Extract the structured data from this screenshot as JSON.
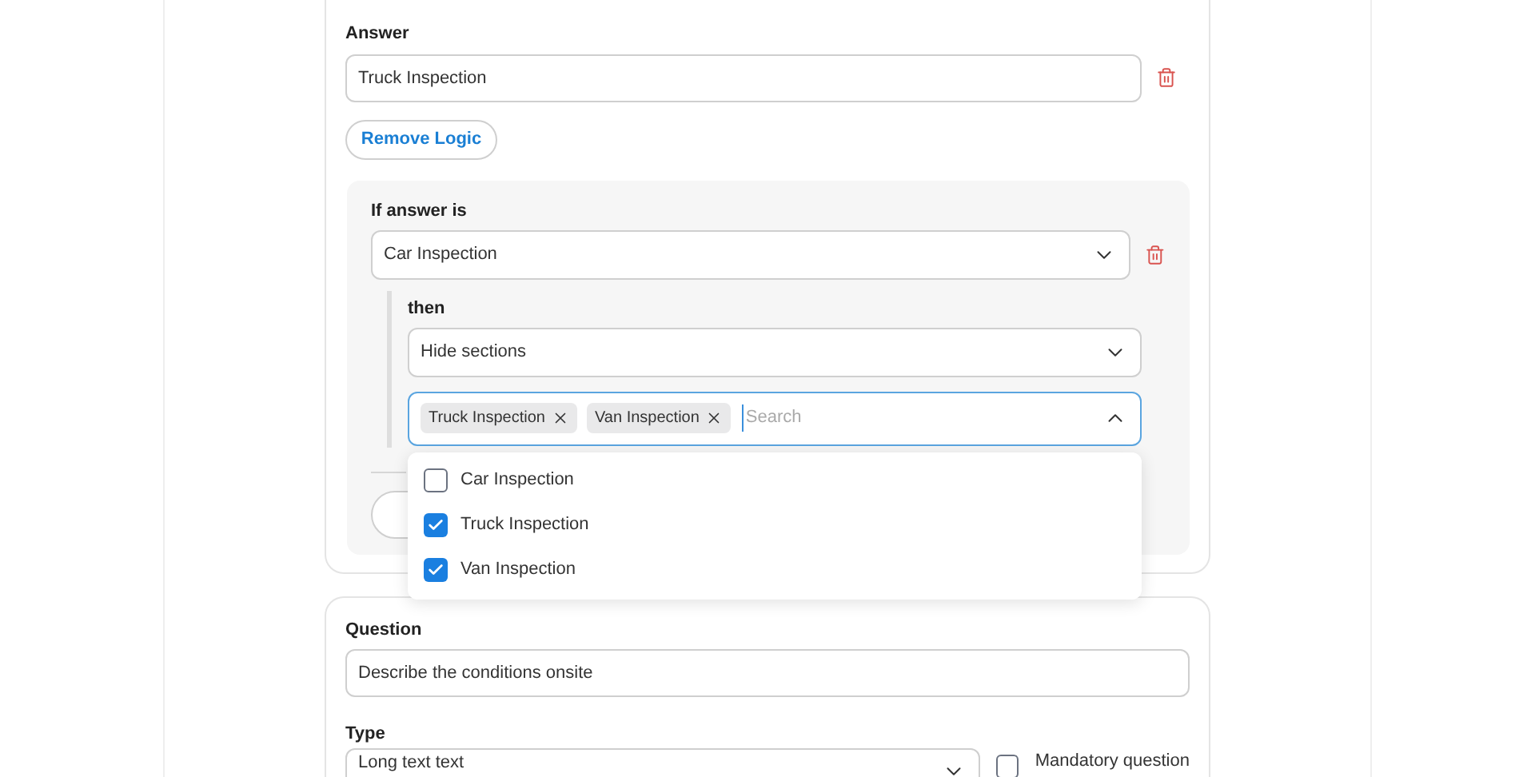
{
  "answer_card": {
    "answer_label": "Answer",
    "answer_value": "Truck Inspection",
    "remove_logic_button": "Remove Logic",
    "logic": {
      "condition_label": "If answer is",
      "condition_value": "Car Inspection",
      "then_label": "then",
      "action_value": "Hide sections",
      "sections_field": {
        "placeholder": "Search",
        "expanded": true,
        "tags": [
          {
            "label": "Truck Inspection"
          },
          {
            "label": "Van Inspection"
          }
        ],
        "options": [
          {
            "label": "Car Inspection",
            "checked": false
          },
          {
            "label": "Truck Inspection",
            "checked": true
          },
          {
            "label": "Van Inspection",
            "checked": true
          }
        ]
      }
    }
  },
  "question_card": {
    "question_label": "Question",
    "question_value": "Describe the conditions onsite",
    "type_label": "Type",
    "type_value": "Long text text",
    "mandatory_label": "Mandatory question",
    "mandatory_checked": false
  }
}
